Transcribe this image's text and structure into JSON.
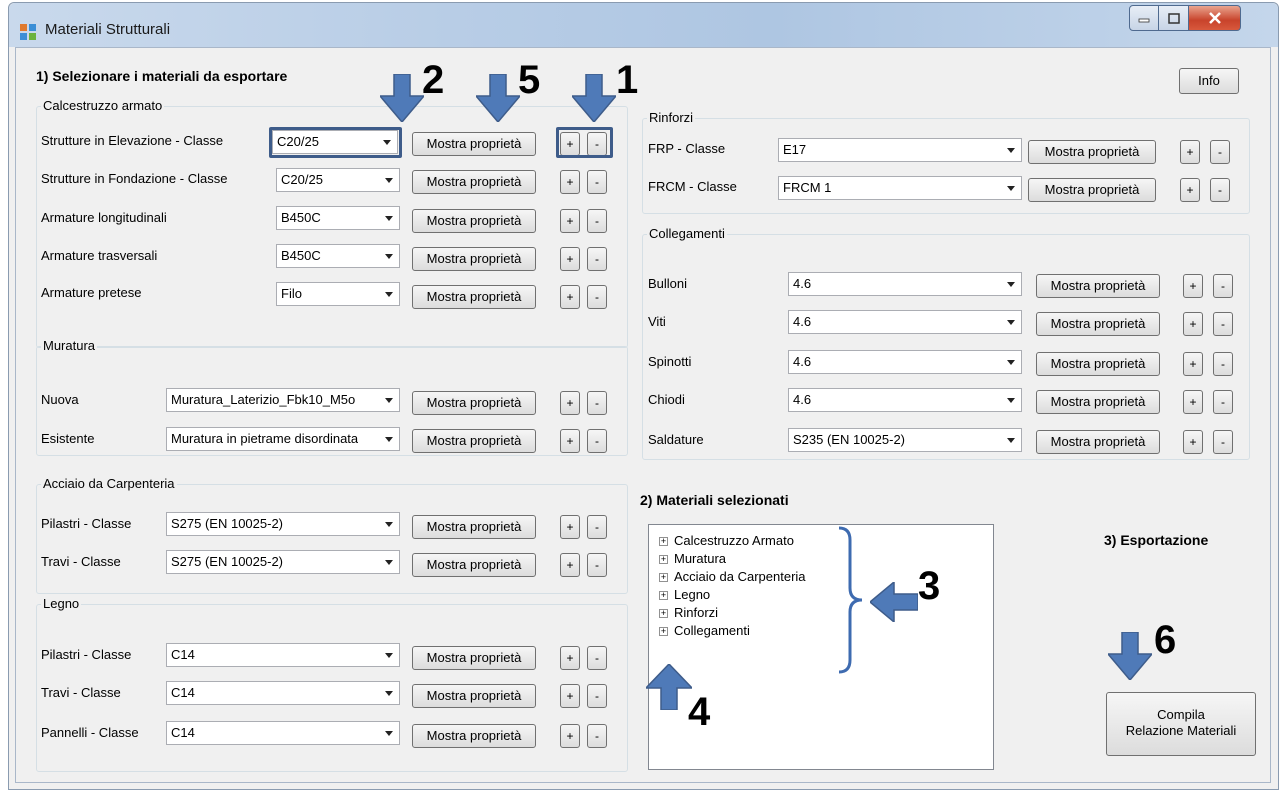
{
  "window": {
    "title": "Materiali Strutturali"
  },
  "section1": {
    "title": "1) Selezionare i materiali da esportare",
    "info_label": "Info"
  },
  "show_label": "Mostra proprietà",
  "plus": "+",
  "minus": "-",
  "calcestruzzo": {
    "label": "Calcestruzzo armato",
    "rows": [
      {
        "label": "Strutture in Elevazione - Classe",
        "value": "C20/25"
      },
      {
        "label": "Strutture in Fondazione - Classe",
        "value": "C20/25"
      },
      {
        "label": "Armature longitudinali",
        "value": "B450C"
      },
      {
        "label": "Armature trasversali",
        "value": "B450C"
      },
      {
        "label": "Armature pretese",
        "value": "Filo"
      }
    ]
  },
  "muratura": {
    "label": "Muratura",
    "rows": [
      {
        "label": "Nuova",
        "value": "Muratura_Laterizio_Fbk10_M5o"
      },
      {
        "label": "Esistente",
        "value": "Muratura in pietrame disordinata"
      }
    ]
  },
  "acciaio": {
    "label": "Acciaio da Carpenteria",
    "rows": [
      {
        "label": "Pilastri - Classe",
        "value": "S275 (EN 10025-2)"
      },
      {
        "label": "Travi - Classe",
        "value": "S275 (EN 10025-2)"
      }
    ]
  },
  "legno": {
    "label": "Legno",
    "rows": [
      {
        "label": "Pilastri - Classe",
        "value": "C14"
      },
      {
        "label": "Travi - Classe",
        "value": "C14"
      },
      {
        "label": "Pannelli - Classe",
        "value": "C14"
      }
    ]
  },
  "rinforzi": {
    "label": "Rinforzi",
    "rows": [
      {
        "label": "FRP - Classe",
        "value": "E17"
      },
      {
        "label": "FRCM - Classe",
        "value": "FRCM 1"
      }
    ]
  },
  "collegamenti": {
    "label": "Collegamenti",
    "rows": [
      {
        "label": "Bulloni",
        "value": "4.6"
      },
      {
        "label": "Viti",
        "value": "4.6"
      },
      {
        "label": "Spinotti",
        "value": "4.6"
      },
      {
        "label": "Chiodi",
        "value": "4.6"
      },
      {
        "label": "Saldature",
        "value": "S235 (EN 10025-2)"
      }
    ]
  },
  "section2": {
    "title": "2) Materiali selezionati",
    "tree": [
      "Calcestruzzo Armato",
      "Muratura",
      "Acciaio da Carpenteria",
      "Legno",
      "Rinforzi",
      "Collegamenti"
    ]
  },
  "section3": {
    "title": "3) Esportazione",
    "button_line1": "Compila",
    "button_line2": "Relazione Materiali"
  },
  "annotations": [
    "1",
    "2",
    "3",
    "4",
    "5",
    "6"
  ],
  "colors": {
    "annotation": "#4f7ab8",
    "annotation_border": "#3e5c8a",
    "close_button": "#c8432b"
  }
}
